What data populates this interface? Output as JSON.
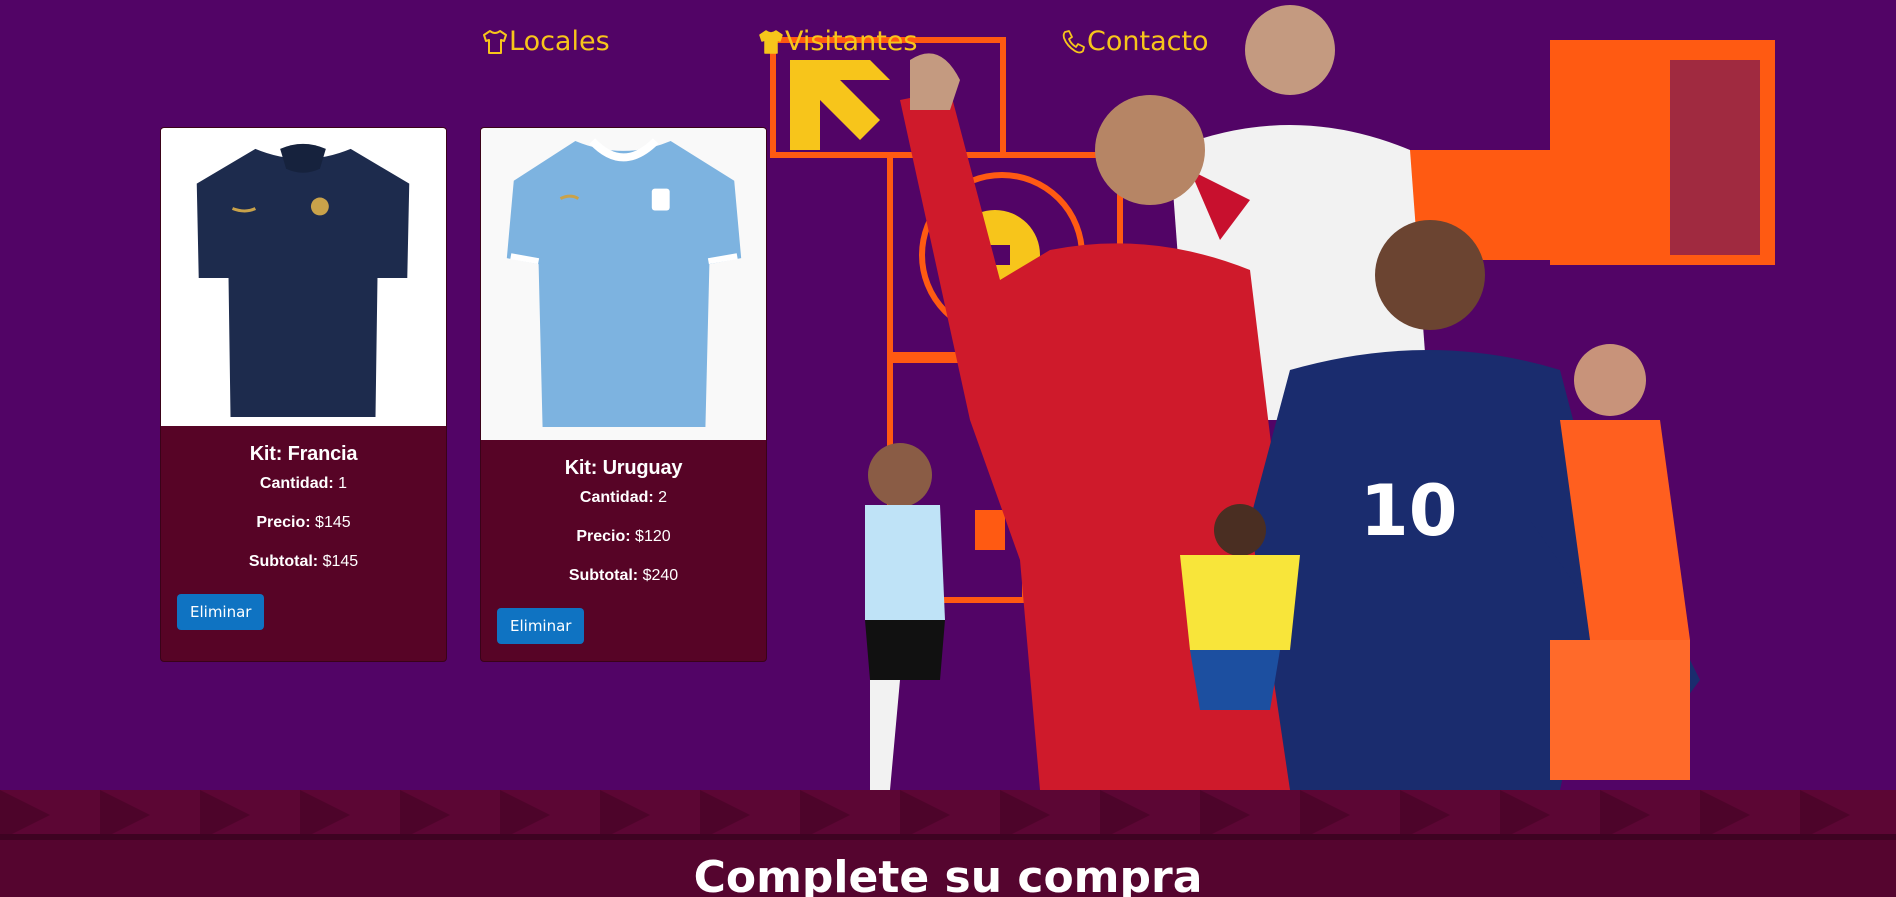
{
  "nav": {
    "items": [
      {
        "label": "Locales",
        "icon": "shirt-outline-icon"
      },
      {
        "label": "Visitantes",
        "icon": "shirt-filled-icon"
      },
      {
        "label": "Contacto",
        "icon": "phone-icon"
      }
    ]
  },
  "cart": {
    "items": [
      {
        "title": "Kit: Francia",
        "quantity_label": "Cantidad:",
        "quantity": "1",
        "price_label": "Precio:",
        "price": "$145",
        "subtotal_label": "Subtotal:",
        "subtotal": "$145",
        "button": "Eliminar",
        "shirt_color": "#1d2b4d"
      },
      {
        "title": "Kit: Uruguay",
        "quantity_label": "Cantidad:",
        "quantity": "2",
        "price_label": "Precio:",
        "price": "$120",
        "subtotal_label": "Subtotal:",
        "subtotal": "$240",
        "button": "Eliminar",
        "shirt_color": "#7db3e0"
      }
    ]
  },
  "checkout": {
    "title": "Complete su compra"
  },
  "colors": {
    "background": "#520466",
    "nav_text": "#f7c51b",
    "card_bg": "#570426",
    "button_bg": "#0f73c2",
    "band_bg": "#55052f",
    "hero_orange": "#ff5a12"
  }
}
